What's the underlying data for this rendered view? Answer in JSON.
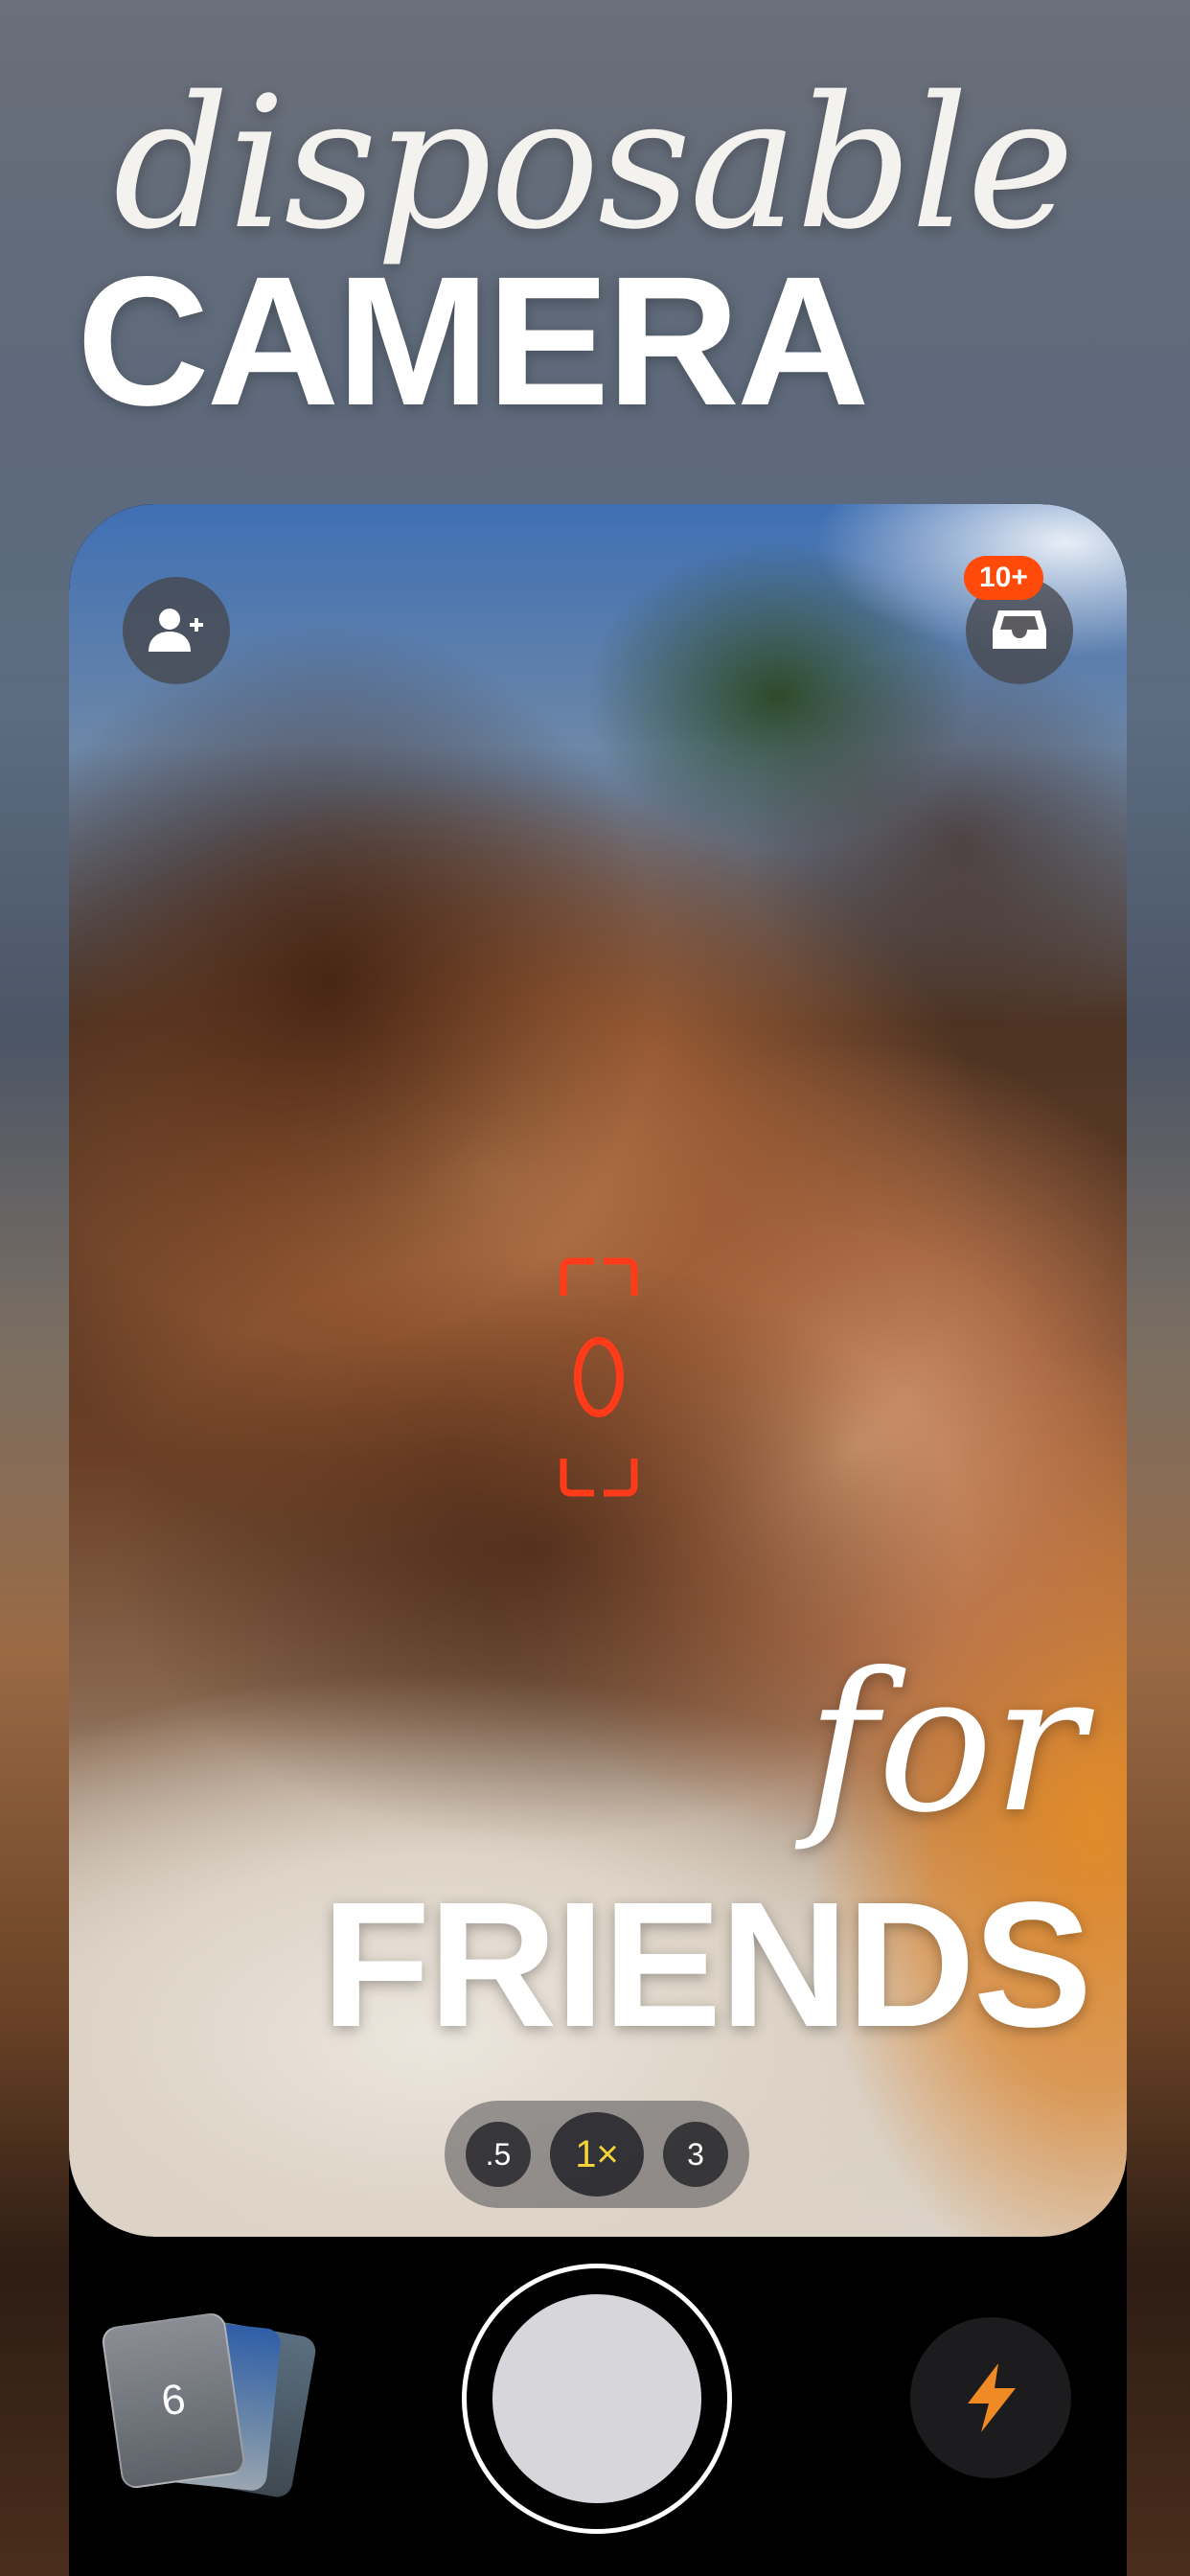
{
  "headline": {
    "script_text": "disposable",
    "bold_text": "CAMERA"
  },
  "tagline": {
    "script_text": "for",
    "bold_text": "FRIENDS"
  },
  "top_controls": {
    "add_friend_icon": "person-plus-icon",
    "inbox_icon": "inbox-tray-icon",
    "inbox_badge": "10+"
  },
  "zoom": {
    "options": [
      ".5",
      "1×",
      "3"
    ],
    "selected": "1×"
  },
  "bottom_controls": {
    "photo_roll_count": "6",
    "flash_icon": "lightning-bolt-icon"
  },
  "colors": {
    "accent_orange": "#ff4a0a",
    "zoom_selected": "#f6d33a",
    "flash_icon": "#f08a24",
    "focus_frame": "#ff3b1a"
  }
}
